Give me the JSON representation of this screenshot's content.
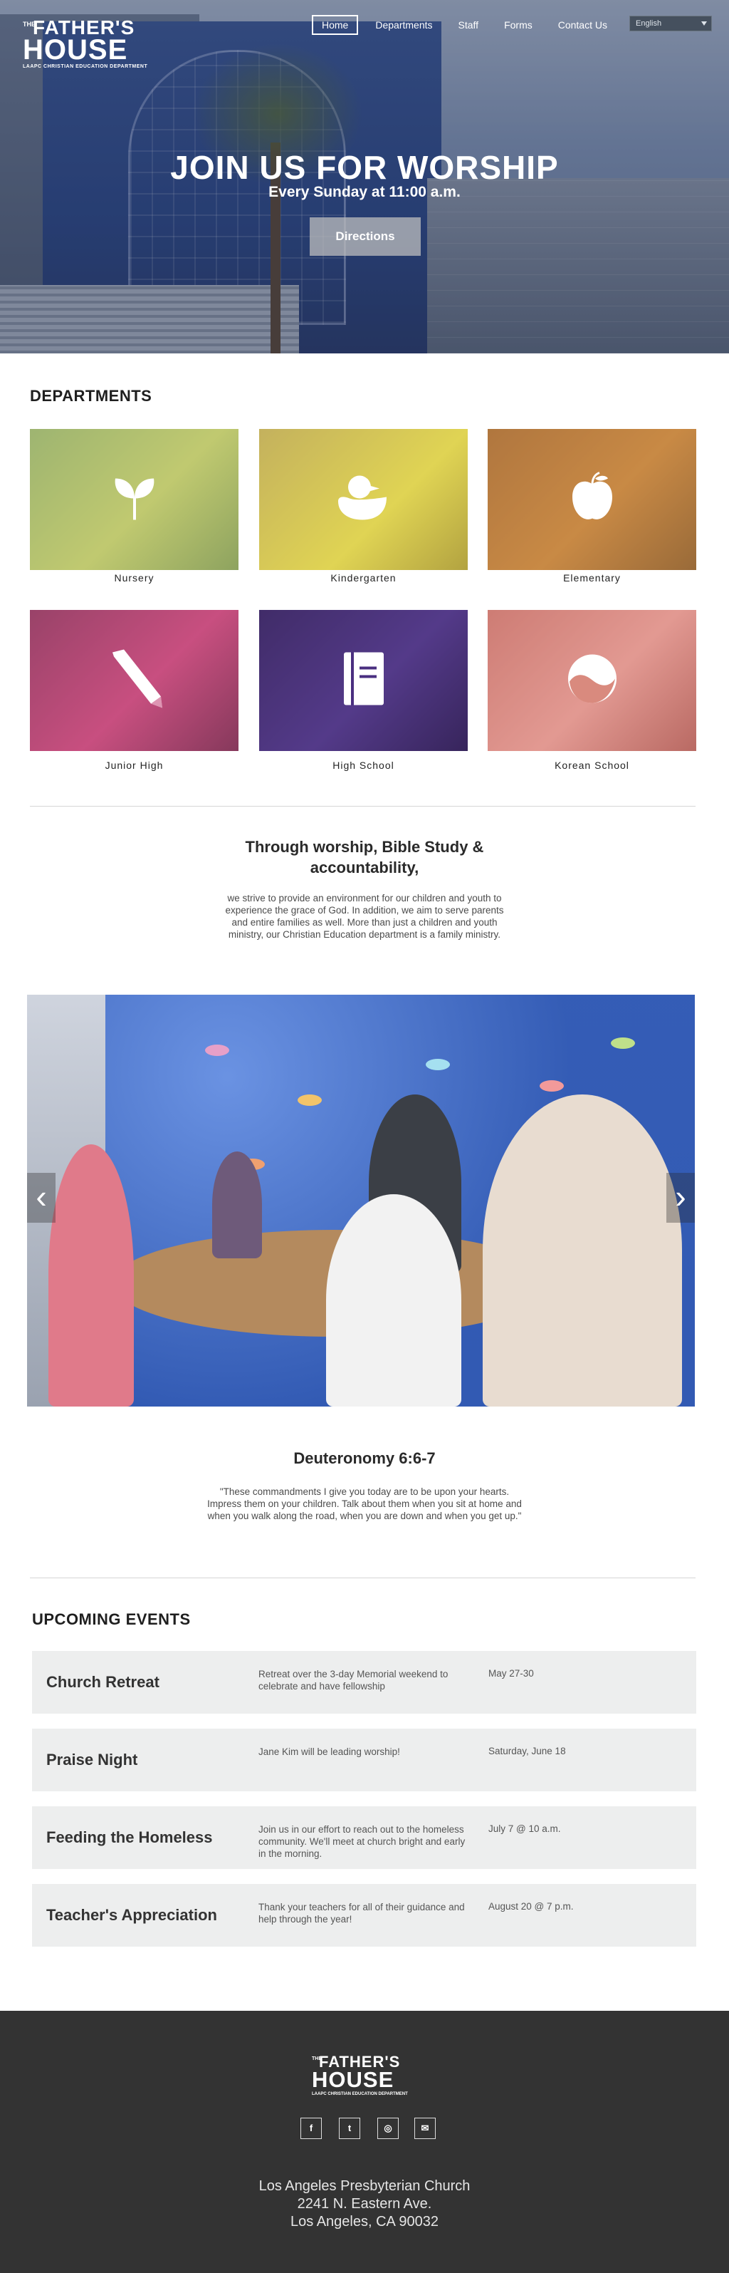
{
  "logo": {
    "the": "THE",
    "line1": "FATHER'S",
    "line2": "HOUSE",
    "line3": "LAAPC CHRISTIAN EDUCATION DEPARTMENT"
  },
  "nav": {
    "items": [
      {
        "label": "Home",
        "active": true
      },
      {
        "label": "Departments"
      },
      {
        "label": "Staff"
      },
      {
        "label": "Forms"
      },
      {
        "label": "Contact Us"
      }
    ],
    "language": "English"
  },
  "hero": {
    "title": "JOIN US FOR WORSHIP",
    "subtitle": "Every Sunday at 11:00 a.m.",
    "button": "Directions"
  },
  "departments": {
    "heading": "DEPARTMENTS",
    "items": [
      {
        "label": "Nursery",
        "icon": "sprout-icon",
        "tint": "#b6d47a"
      },
      {
        "label": "Kindergarten",
        "icon": "duck-icon",
        "tint": "#d8c84a"
      },
      {
        "label": "Elementary",
        "icon": "apple-icon",
        "tint": "#c98a45"
      },
      {
        "label": "Junior High",
        "icon": "pencil-icon",
        "tint": "#c84f80"
      },
      {
        "label": "High School",
        "icon": "notebook-icon",
        "tint": "#4a2f80"
      },
      {
        "label": "Korean School",
        "icon": "yin-yang-icon",
        "tint": "#d96a6a"
      }
    ]
  },
  "mission": {
    "title": "Through worship, Bible Study & accountability,",
    "body": "we strive to provide an environment for our children and youth to experience the grace of God.  In addition, we aim to serve parents and entire families as well. More than just a children and youth ministry, our Christian Education department is a family ministry."
  },
  "slider": {
    "prev": "‹",
    "next": "›"
  },
  "verse": {
    "title": "Deuteronomy 6:6-7",
    "body": "\"These commandments I give you today are to be upon your hearts. Impress them on your children. Talk about them when you sit at home and when you walk along the  road, when you are down and when you get up.\""
  },
  "events": {
    "heading": "UPCOMING EVENTS",
    "items": [
      {
        "name": "Church Retreat",
        "desc": "Retreat over the 3-day Memorial weekend to celebrate and have fellowship",
        "when": "May 27-30"
      },
      {
        "name": "Praise Night",
        "desc": "Jane Kim will be leading worship!",
        "when": "Saturday, June 18"
      },
      {
        "name": "Feeding the Homeless",
        "desc": "Join us in our effort to reach out to the homeless community. We'll meet at church bright and early in the morning.",
        "when": "July 7 @ 10 a.m."
      },
      {
        "name": "Teacher's Appreciation",
        "desc": "Thank your teachers for all of their guidance and help through the year!",
        "when": "August 20 @ 7 p.m."
      }
    ]
  },
  "footer": {
    "social": [
      {
        "icon": "facebook-icon",
        "glyph": "f"
      },
      {
        "icon": "twitter-icon",
        "glyph": "t"
      },
      {
        "icon": "instagram-icon",
        "glyph": "◎"
      },
      {
        "icon": "email-icon",
        "glyph": "✉"
      }
    ],
    "address": [
      "Los Angeles Presbyterian Church",
      "2241 N. Eastern Ave.",
      "Los Angeles, CA 90032"
    ]
  }
}
